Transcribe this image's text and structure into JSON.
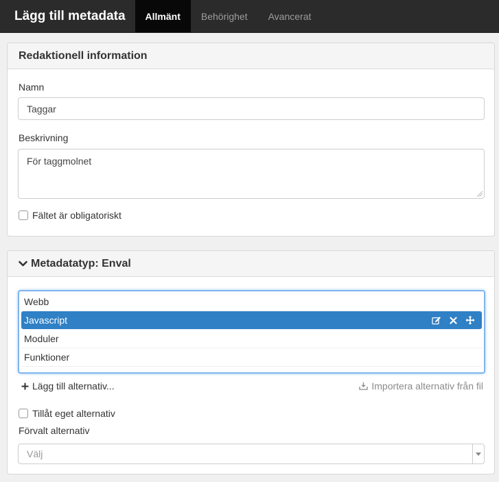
{
  "app": {
    "title": "Lägg till metadata"
  },
  "tabs": [
    {
      "label": "Allmänt",
      "active": true
    },
    {
      "label": "Behörighet",
      "active": false
    },
    {
      "label": "Avancerat",
      "active": false
    }
  ],
  "editorial": {
    "heading": "Redaktionell information",
    "name_label": "Namn",
    "name_value": "Taggar",
    "desc_label": "Beskrivning",
    "desc_value": "För taggmolnet",
    "required_label": "Fältet är obligatoriskt",
    "required_checked": false
  },
  "metadata_type": {
    "heading": "Metadatatyp: Enval",
    "options": [
      {
        "label": "Webb",
        "selected": false
      },
      {
        "label": "Javascript",
        "selected": true
      },
      {
        "label": "Moduler",
        "selected": false
      },
      {
        "label": "Funktioner",
        "selected": false
      }
    ],
    "add_option_label": "Lägg till alternativ...",
    "import_label": "Importera alternativ från fil",
    "allow_custom_label": "Tillåt eget alternativ",
    "allow_custom_checked": false,
    "default_label": "Förvalt alternativ",
    "default_placeholder": "Välj"
  },
  "icons": {
    "chevron": "chevron-down-icon",
    "edit": "edit-icon",
    "remove": "close-icon",
    "move": "move-icon",
    "plus": "plus-icon",
    "import": "import-icon",
    "select_arrow": "caret-down-icon"
  },
  "colors": {
    "topbar": "#2b2b2b",
    "active_tab": "#080808",
    "selected_row": "#2f80c5",
    "focus_border": "#7fb4ec"
  }
}
